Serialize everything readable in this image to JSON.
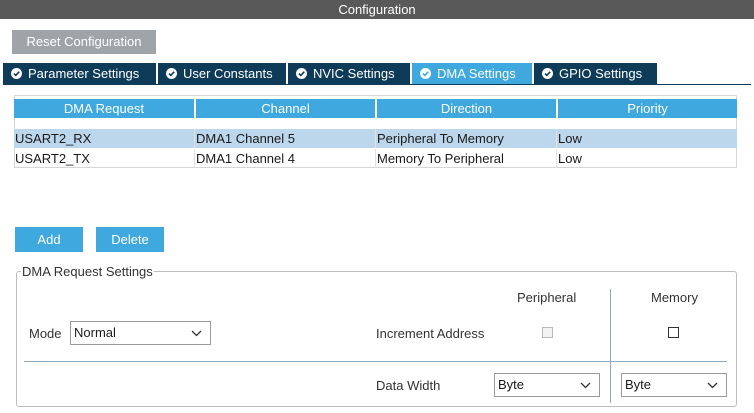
{
  "window": {
    "title": "Configuration"
  },
  "toolbar": {
    "reset_label": "Reset Configuration"
  },
  "tabs": [
    {
      "label": "Parameter Settings",
      "active": false,
      "icon": "check-circle-icon"
    },
    {
      "label": "User Constants",
      "active": false,
      "icon": "check-circle-icon"
    },
    {
      "label": "NVIC Settings",
      "active": false,
      "icon": "check-circle-icon"
    },
    {
      "label": "DMA Settings",
      "active": true,
      "icon": "check-circle-icon"
    },
    {
      "label": "GPIO Settings",
      "active": false,
      "icon": "check-circle-icon"
    }
  ],
  "table": {
    "columns": [
      "DMA Request",
      "Channel",
      "Direction",
      "Priority"
    ],
    "rows": [
      {
        "request": "USART2_RX",
        "channel": "DMA1 Channel 5",
        "direction": "Peripheral To Memory",
        "priority": "Low",
        "selected": true
      },
      {
        "request": "USART2_TX",
        "channel": "DMA1 Channel 4",
        "direction": "Memory To Peripheral",
        "priority": "Low",
        "selected": false
      }
    ]
  },
  "actions": {
    "add_label": "Add",
    "delete_label": "Delete"
  },
  "settings": {
    "legend": "DMA Request Settings",
    "peripheral_header": "Peripheral",
    "memory_header": "Memory",
    "mode_label": "Mode",
    "mode_value": "Normal",
    "increment_label": "Increment Address",
    "peripheral_increment_checked": false,
    "memory_increment_checked": false,
    "data_width_label": "Data Width",
    "peripheral_width_value": "Byte",
    "memory_width_value": "Byte"
  },
  "colors": {
    "title_bar": "#595959",
    "tab_inactive": "#0e3b57",
    "accent_blue": "#3ea8df",
    "row_selected": "#bcd6ec",
    "reset_button": "#9fa4a8"
  }
}
